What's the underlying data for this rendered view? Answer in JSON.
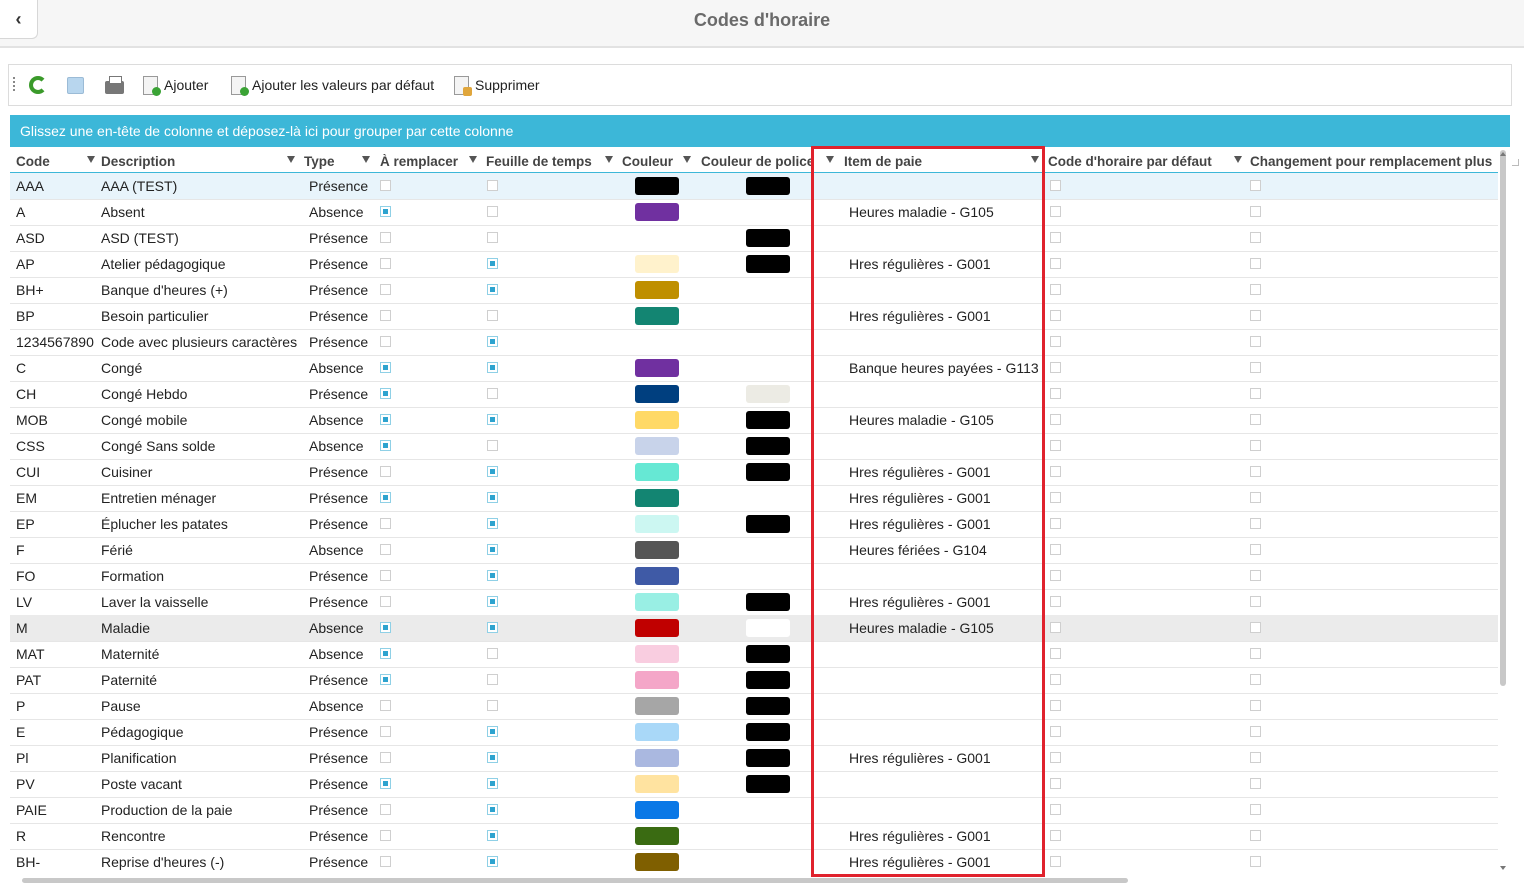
{
  "header": {
    "title": "Codes d'horaire",
    "back_icon": "chevron-left-icon"
  },
  "toolbar": {
    "refresh_icon": "refresh-icon",
    "save_icon": "save-icon",
    "print_icon": "printer-icon",
    "add_label": "Ajouter",
    "add_defaults_label": "Ajouter les valeurs par défaut",
    "delete_label": "Supprimer"
  },
  "group_bar": {
    "text": "Glissez une en-tête de colonne et déposez-là ici pour grouper par cette colonne"
  },
  "colors": {
    "accent": "#3cb7d8",
    "highlight_border": "#e0222d",
    "checkbox_on": "#2da3cf"
  },
  "columns": [
    "Code",
    "Description",
    "Type",
    "À remplacer",
    "Feuille de temps",
    "Couleur",
    "Couleur de police",
    "Item de paie",
    "Code d'horaire par défaut",
    "Changement pour remplacement plus"
  ],
  "rows": [
    {
      "code": "AAA",
      "description": "AAA (TEST)",
      "type": "Présence",
      "remplacer": false,
      "feuille": false,
      "couleur": "#000000",
      "police": "#000000",
      "item": "",
      "defaut": false,
      "changement": false,
      "state": "selected"
    },
    {
      "code": "A",
      "description": "Absent",
      "type": "Absence",
      "remplacer": true,
      "feuille": false,
      "couleur": "#7030a0",
      "police": "",
      "item": "Heures maladie - G105",
      "defaut": false,
      "changement": false,
      "state": ""
    },
    {
      "code": "ASD",
      "description": "ASD (TEST)",
      "type": "Présence",
      "remplacer": false,
      "feuille": false,
      "couleur": "",
      "police": "#000000",
      "item": "",
      "defaut": false,
      "changement": false,
      "state": ""
    },
    {
      "code": "AP",
      "description": "Atelier pédagogique",
      "type": "Présence",
      "remplacer": false,
      "feuille": true,
      "couleur": "#fff2cc",
      "police": "#000000",
      "item": "Hres régulières - G001",
      "defaut": false,
      "changement": false,
      "state": ""
    },
    {
      "code": "BH+",
      "description": "Banque d'heures (+)",
      "type": "Présence",
      "remplacer": false,
      "feuille": true,
      "couleur": "#bf8f00",
      "police": "",
      "item": "",
      "defaut": false,
      "changement": false,
      "state": ""
    },
    {
      "code": "BP",
      "description": "Besoin particulier",
      "type": "Présence",
      "remplacer": false,
      "feuille": false,
      "couleur": "#138572",
      "police": "",
      "item": "Hres régulières - G001",
      "defaut": false,
      "changement": false,
      "state": ""
    },
    {
      "code": "1234567890",
      "description": "Code avec plusieurs caractères",
      "type": "Présence",
      "remplacer": false,
      "feuille": true,
      "couleur": "",
      "police": "",
      "item": "",
      "defaut": false,
      "changement": false,
      "state": ""
    },
    {
      "code": "C",
      "description": "Congé",
      "type": "Absence",
      "remplacer": true,
      "feuille": true,
      "couleur": "#7030a0",
      "police": "",
      "item": "Banque heures payées - G113",
      "defaut": false,
      "changement": false,
      "state": ""
    },
    {
      "code": "CH",
      "description": "Congé Hebdo",
      "type": "Présence",
      "remplacer": true,
      "feuille": false,
      "couleur": "#003f7f",
      "police": "#ecebe4",
      "item": "",
      "defaut": false,
      "changement": false,
      "state": ""
    },
    {
      "code": "MOB",
      "description": "Congé mobile",
      "type": "Absence",
      "remplacer": true,
      "feuille": true,
      "couleur": "#ffd966",
      "police": "#000000",
      "item": "Heures maladie - G105",
      "defaut": false,
      "changement": false,
      "state": ""
    },
    {
      "code": "CSS",
      "description": "Congé Sans solde",
      "type": "Absence",
      "remplacer": true,
      "feuille": false,
      "couleur": "#c8d3ea",
      "police": "#000000",
      "item": "",
      "defaut": false,
      "changement": false,
      "state": ""
    },
    {
      "code": "CUI",
      "description": "Cuisiner",
      "type": "Présence",
      "remplacer": false,
      "feuille": true,
      "couleur": "#66e8d4",
      "police": "#000000",
      "item": "Hres régulières - G001",
      "defaut": false,
      "changement": false,
      "state": ""
    },
    {
      "code": "EM",
      "description": "Entretien ménager",
      "type": "Présence",
      "remplacer": true,
      "feuille": true,
      "couleur": "#138572",
      "police": "",
      "item": "Hres régulières - G001",
      "defaut": false,
      "changement": false,
      "state": ""
    },
    {
      "code": "EP",
      "description": "Éplucher les patates",
      "type": "Présence",
      "remplacer": false,
      "feuille": true,
      "couleur": "#ccf7f2",
      "police": "#000000",
      "item": "Hres régulières - G001",
      "defaut": false,
      "changement": false,
      "state": ""
    },
    {
      "code": "F",
      "description": "Férié",
      "type": "Absence",
      "remplacer": false,
      "feuille": true,
      "couleur": "#555555",
      "police": "",
      "item": "Heures fériées - G104",
      "defaut": false,
      "changement": false,
      "state": ""
    },
    {
      "code": "FO",
      "description": "Formation",
      "type": "Présence",
      "remplacer": false,
      "feuille": true,
      "couleur": "#3f5aa6",
      "police": "",
      "item": "",
      "defaut": false,
      "changement": false,
      "state": ""
    },
    {
      "code": "LV",
      "description": "Laver la vaisselle",
      "type": "Présence",
      "remplacer": false,
      "feuille": true,
      "couleur": "#99efe4",
      "police": "#000000",
      "item": "Hres régulières - G001",
      "defaut": false,
      "changement": false,
      "state": ""
    },
    {
      "code": "M",
      "description": "Maladie",
      "type": "Absence",
      "remplacer": true,
      "feuille": true,
      "couleur": "#c00000",
      "police": "#ffffff",
      "item": "Heures maladie - G105",
      "defaut": false,
      "changement": false,
      "state": "highlight"
    },
    {
      "code": "MAT",
      "description": "Maternité",
      "type": "Absence",
      "remplacer": true,
      "feuille": false,
      "couleur": "#f9cde0",
      "police": "#000000",
      "item": "",
      "defaut": false,
      "changement": false,
      "state": ""
    },
    {
      "code": "PAT",
      "description": "Paternité",
      "type": "Présence",
      "remplacer": true,
      "feuille": false,
      "couleur": "#f4a6c8",
      "police": "#000000",
      "item": "",
      "defaut": false,
      "changement": false,
      "state": ""
    },
    {
      "code": "P",
      "description": "Pause",
      "type": "Absence",
      "remplacer": false,
      "feuille": false,
      "couleur": "#a6a6a6",
      "police": "#000000",
      "item": "",
      "defaut": false,
      "changement": false,
      "state": ""
    },
    {
      "code": "E",
      "description": "Pédagogique",
      "type": "Présence",
      "remplacer": false,
      "feuille": true,
      "couleur": "#a9d8f8",
      "police": "#000000",
      "item": "",
      "defaut": false,
      "changement": false,
      "state": ""
    },
    {
      "code": "Pl",
      "description": "Planification",
      "type": "Présence",
      "remplacer": false,
      "feuille": true,
      "couleur": "#aab8e0",
      "police": "#000000",
      "item": "Hres régulières - G001",
      "defaut": false,
      "changement": false,
      "state": ""
    },
    {
      "code": "PV",
      "description": "Poste vacant",
      "type": "Présence",
      "remplacer": true,
      "feuille": true,
      "couleur": "#ffe3a0",
      "police": "#000000",
      "item": "",
      "defaut": false,
      "changement": false,
      "state": ""
    },
    {
      "code": "PAIE",
      "description": "Production de la paie",
      "type": "Présence",
      "remplacer": false,
      "feuille": true,
      "couleur": "#0a78e6",
      "police": "",
      "item": "",
      "defaut": false,
      "changement": false,
      "state": ""
    },
    {
      "code": "R",
      "description": "Rencontre",
      "type": "Présence",
      "remplacer": false,
      "feuille": true,
      "couleur": "#3a6b12",
      "police": "",
      "item": "Hres régulières - G001",
      "defaut": false,
      "changement": false,
      "state": ""
    },
    {
      "code": "BH-",
      "description": "Reprise d'heures (-)",
      "type": "Présence",
      "remplacer": false,
      "feuille": true,
      "couleur": "#7f5f00",
      "police": "",
      "item": "Hres régulières - G001",
      "defaut": false,
      "changement": false,
      "state": ""
    }
  ]
}
